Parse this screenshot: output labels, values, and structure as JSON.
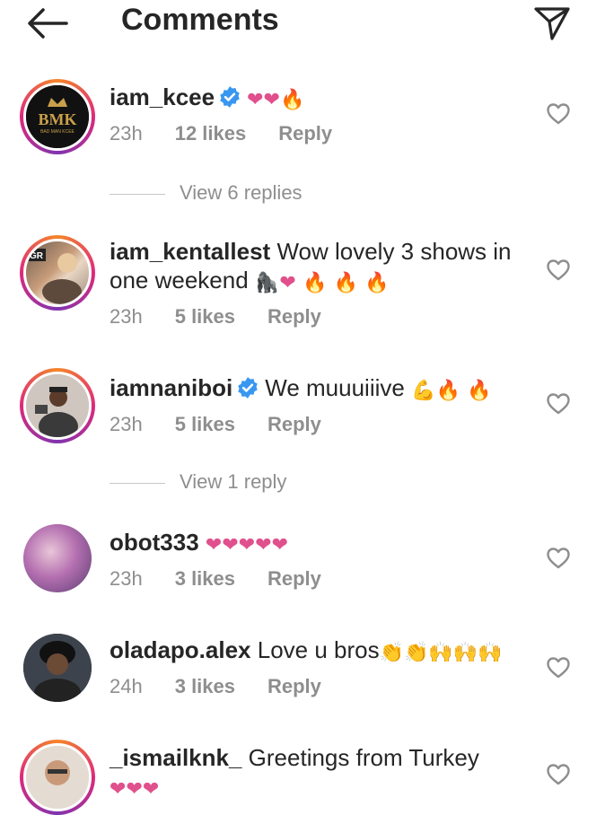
{
  "header": {
    "title": "Comments"
  },
  "comments": [
    {
      "username": "iam_kcee",
      "verified": true,
      "text": "",
      "emojis": [
        "heart",
        "heart",
        "fire"
      ],
      "time": "23h",
      "likes": "12 likes",
      "reply": "Reply",
      "avatar_text": "BMK",
      "avatar_subtext": "BAD MAN KCEE",
      "view_replies": "View 6 replies"
    },
    {
      "username": "iam_kentallest",
      "verified": false,
      "text": "Wow lovely 3 shows in",
      "text2": "one weekend",
      "emojis2": [
        "gorilla",
        "heart",
        "fire",
        "fire",
        "fire"
      ],
      "time": "23h",
      "likes": "5 likes",
      "reply": "Reply",
      "avatar_text": "GR"
    },
    {
      "username": "iamnaniboi",
      "verified": true,
      "text": "We muuuiiive",
      "emojis": [
        "muscle",
        "fire",
        "fire"
      ],
      "time": "23h",
      "likes": "5 likes",
      "reply": "Reply",
      "view_replies": "View 1 reply"
    },
    {
      "username": "obot333",
      "verified": false,
      "text": "",
      "emojis": [
        "heart",
        "heart",
        "heart",
        "heart",
        "heart"
      ],
      "time": "23h",
      "likes": "3 likes",
      "reply": "Reply"
    },
    {
      "username": "oladapo.alex",
      "verified": false,
      "text": "Love u bros",
      "emojis": [
        "clap",
        "clap",
        "raised-hands",
        "raised-hands",
        "raised-hands"
      ],
      "time": "24h",
      "likes": "3 likes",
      "reply": "Reply"
    },
    {
      "username": "_ismailknk_",
      "verified": false,
      "text": "Greetings from Turkey",
      "emojis2": [
        "heart",
        "heart",
        "heart"
      ]
    }
  ],
  "icons": {
    "back": "arrow-left-icon",
    "send": "paper-plane-icon",
    "like": "heart-outline-icon",
    "verified": "verified-badge-icon"
  },
  "colors": {
    "accent": "#262626",
    "muted": "#8e8e8e",
    "verified": "#3897f0",
    "heart": "#e0508c",
    "fire": "#f26b1d"
  }
}
